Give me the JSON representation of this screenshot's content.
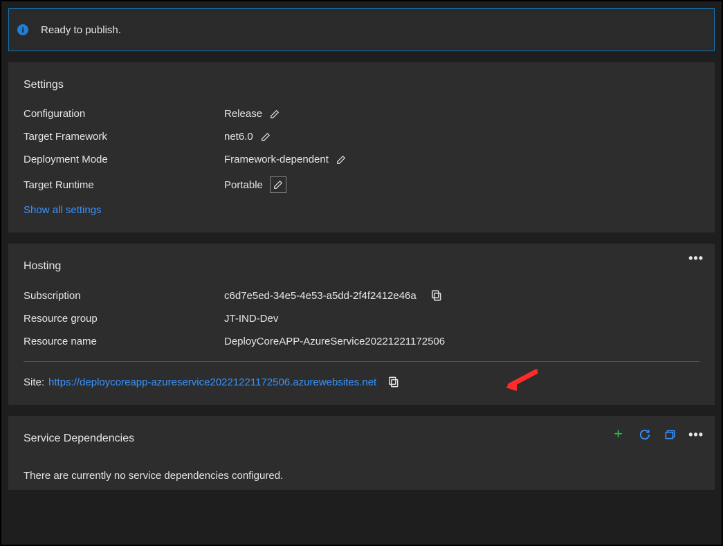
{
  "notice": {
    "message": "Ready to publish."
  },
  "settings": {
    "title": "Settings",
    "rows": {
      "configuration": {
        "label": "Configuration",
        "value": "Release"
      },
      "target_framework": {
        "label": "Target Framework",
        "value": "net6.0"
      },
      "deployment_mode": {
        "label": "Deployment Mode",
        "value": "Framework-dependent"
      },
      "target_runtime": {
        "label": "Target Runtime",
        "value": "Portable"
      }
    },
    "show_all_label": "Show all settings"
  },
  "hosting": {
    "title": "Hosting",
    "rows": {
      "subscription": {
        "label": "Subscription",
        "value": "c6d7e5ed-34e5-4e53-a5dd-2f4f2412e46a"
      },
      "resource_group": {
        "label": "Resource group",
        "value": "JT-IND-Dev"
      },
      "resource_name": {
        "label": "Resource name",
        "value": "DeployCoreAPP-AzureService20221221172506"
      }
    },
    "site_label": "Site:",
    "site_url": "https://deploycoreapp-azureservice20221221172506.azurewebsites.net"
  },
  "deps": {
    "title": "Service Dependencies",
    "empty_message": "There are currently no service dependencies configured."
  }
}
